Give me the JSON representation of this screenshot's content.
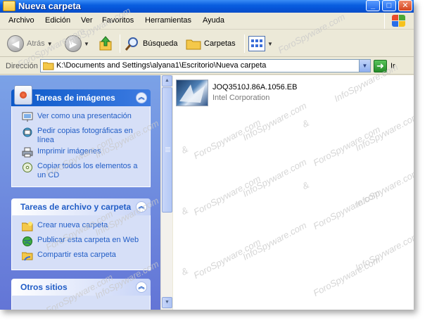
{
  "window": {
    "title": "Nueva carpeta"
  },
  "title_buttons": {
    "minimize": "_",
    "maximize": "□",
    "close": "✕"
  },
  "menu": [
    "Archivo",
    "Edición",
    "Ver",
    "Favoritos",
    "Herramientas",
    "Ayuda"
  ],
  "toolbar": {
    "back": "Atrás",
    "search": "Búsqueda",
    "folders": "Carpetas"
  },
  "address": {
    "label": "Dirección",
    "path": "K:\\Documents and Settings\\alyana1\\Escritorio\\Nueva carpeta",
    "go": "Ir"
  },
  "panels": [
    {
      "title": "Tareas de imágenes",
      "tasks": [
        {
          "label": "Ver como una presentación",
          "icon": "slideshow-icon"
        },
        {
          "label": "Pedir copias fotográficas en línea",
          "icon": "order-prints-icon"
        },
        {
          "label": "Imprimir imágenes",
          "icon": "printer-icon"
        },
        {
          "label": "Copiar todos los elementos a un CD",
          "icon": "cd-icon"
        }
      ]
    },
    {
      "title": "Tareas de archivo y carpeta",
      "tasks": [
        {
          "label": "Crear nueva carpeta",
          "icon": "new-folder-icon"
        },
        {
          "label": "Publicar esta carpeta en Web",
          "icon": "globe-icon"
        },
        {
          "label": "Compartir esta carpeta",
          "icon": "share-folder-icon"
        }
      ]
    },
    {
      "title": "Otros sitios",
      "tasks": []
    }
  ],
  "files": [
    {
      "name": "JOQ3510J.86A.1056.EB",
      "company": "Intel Corporation"
    }
  ],
  "watermark": {
    "text": "InfoSpyware.com",
    "text2": "ForoSpyware.com",
    "amp": "&"
  },
  "colors": {
    "titlebar": "#0a5fe0",
    "taskpane": "#6f8fe0",
    "link": "#215dc6"
  }
}
